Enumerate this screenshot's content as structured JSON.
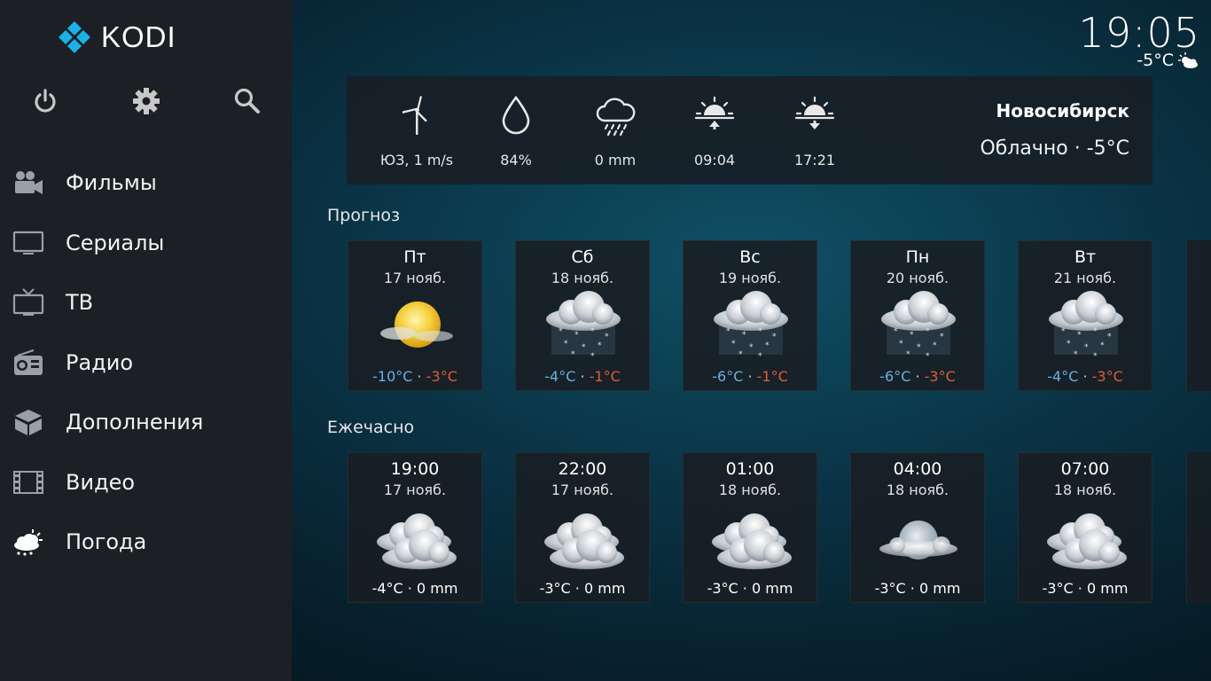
{
  "app": {
    "name": "KODI"
  },
  "clock": {
    "time": "19:05",
    "temp": "-5°C",
    "icon": "partly-cloudy-icon"
  },
  "sidebar": {
    "top_icons": [
      {
        "name": "power-icon"
      },
      {
        "name": "settings-gear-icon"
      },
      {
        "name": "search-icon"
      }
    ],
    "items": [
      {
        "label": "Фильмы",
        "icon": "movie-camera-icon"
      },
      {
        "label": "Сериалы",
        "icon": "tv-screen-icon"
      },
      {
        "label": "ТВ",
        "icon": "tv-antenna-icon"
      },
      {
        "label": "Радио",
        "icon": "radio-icon"
      },
      {
        "label": "Дополнения",
        "icon": "addons-box-icon"
      },
      {
        "label": "Видео",
        "icon": "film-strip-icon"
      },
      {
        "label": "Погода",
        "icon": "weather-icon"
      }
    ]
  },
  "current": {
    "wind": "ЮЗ, 1 m/s",
    "humidity": "84%",
    "precipitation": "0 mm",
    "sunrise": "09:04",
    "sunset": "17:21",
    "city": "Новосибирск",
    "condition": "Облачно · -5°C"
  },
  "forecast": {
    "title": "Прогноз",
    "days": [
      {
        "day": "Пт",
        "date": "17 нояб.",
        "low": "-10°C",
        "sep": "·",
        "high": "-3°C",
        "icon": "sunny-haze-icon"
      },
      {
        "day": "Сб",
        "date": "18 нояб.",
        "low": "-4°C",
        "sep": "·",
        "high": "-1°C",
        "icon": "snow-icon"
      },
      {
        "day": "Вс",
        "date": "19 нояб.",
        "low": "-6°C",
        "sep": "·",
        "high": "-1°C",
        "icon": "snow-icon"
      },
      {
        "day": "Пн",
        "date": "20 нояб.",
        "low": "-6°C",
        "sep": "·",
        "high": "-3°C",
        "icon": "snow-icon"
      },
      {
        "day": "Вт",
        "date": "21 нояб.",
        "low": "-4°C",
        "sep": "·",
        "high": "-3°C",
        "icon": "snow-icon"
      }
    ]
  },
  "hourly": {
    "title": "Ежечасно",
    "hours": [
      {
        "time": "19:00",
        "date": "17 нояб.",
        "info": "-4°C · 0 mm",
        "icon": "cloudy-icon"
      },
      {
        "time": "22:00",
        "date": "17 нояб.",
        "info": "-3°C · 0 mm",
        "icon": "cloudy-icon"
      },
      {
        "time": "01:00",
        "date": "18 нояб.",
        "info": "-3°C · 0 mm",
        "icon": "cloudy-icon"
      },
      {
        "time": "04:00",
        "date": "18 нояб.",
        "info": "-3°C · 0 mm",
        "icon": "cloudy-moon-icon"
      },
      {
        "time": "07:00",
        "date": "18 нояб.",
        "info": "-3°C · 0 mm",
        "icon": "cloudy-icon"
      }
    ]
  }
}
